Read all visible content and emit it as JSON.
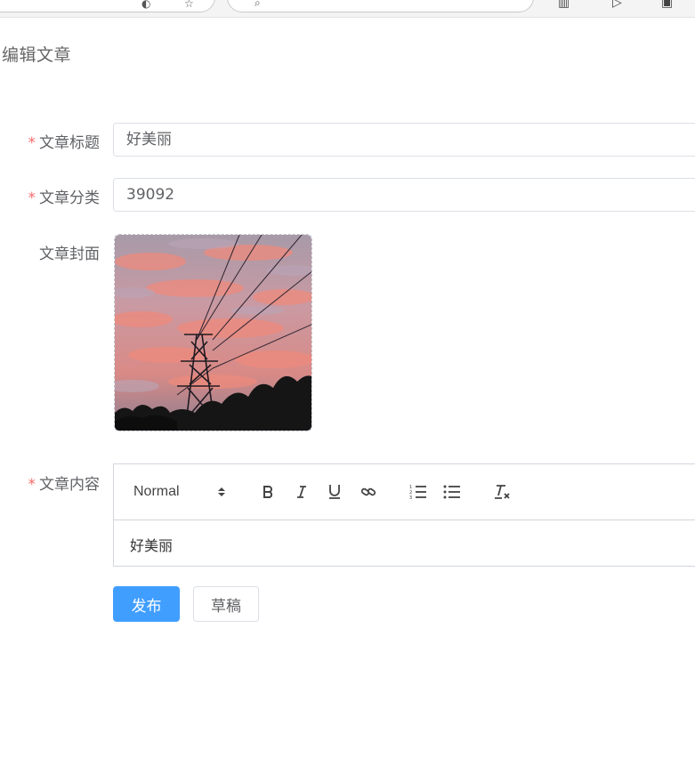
{
  "page": {
    "title": "编辑文章"
  },
  "form": {
    "title_field": {
      "label": "文章标题",
      "value": "好美丽",
      "required": true
    },
    "category_field": {
      "label": "文章分类",
      "value": "39092",
      "required": true
    },
    "cover_field": {
      "label": "文章封面",
      "required": false,
      "image": "sunset-power-tower-photo"
    },
    "content_field": {
      "label": "文章内容",
      "required": true,
      "body": "好美丽"
    },
    "required_mark": "*"
  },
  "editor": {
    "header_select": "Normal",
    "tools": [
      "select-arrows-icon",
      "bold-icon",
      "italic-icon",
      "underline-icon",
      "link-icon",
      "ordered-list-icon",
      "bullet-list-icon",
      "clear-format-icon"
    ]
  },
  "buttons": {
    "publish": "发布",
    "draft": "草稿"
  },
  "colors": {
    "primary": "#409eff",
    "required": "#f56c6c",
    "text": "#606266",
    "border": "#dcdfe6"
  }
}
